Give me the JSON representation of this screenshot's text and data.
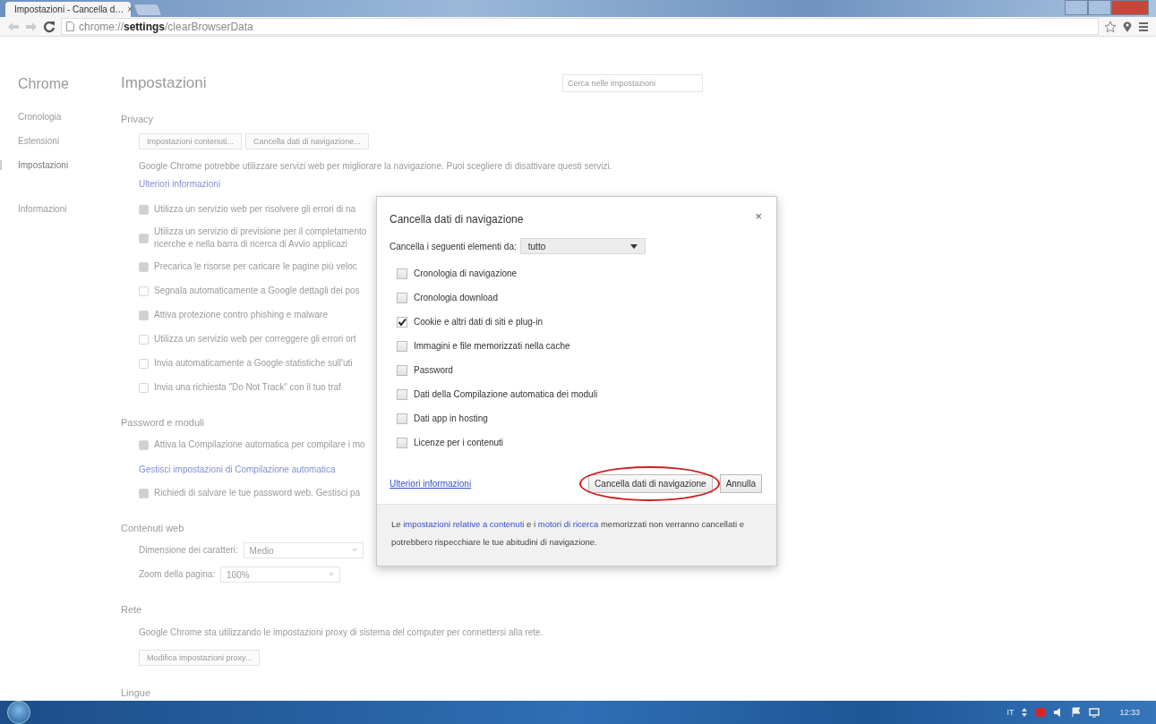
{
  "browser": {
    "tab": {
      "title": "Impostazioni - Cancella d…",
      "close": "×"
    },
    "address": {
      "prefix": "chrome://",
      "bold": "settings",
      "rest": "/clearBrowserData"
    }
  },
  "sidebar": {
    "title": "Chrome",
    "items": [
      {
        "label": "Cronologia",
        "selected": false
      },
      {
        "label": "Estensioni",
        "selected": false
      },
      {
        "label": "Impostazioni",
        "selected": true
      },
      {
        "label": "Informazioni",
        "selected": false
      }
    ]
  },
  "settings": {
    "title": "Impostazioni",
    "search": {
      "placeholder": "Cerca nelle impostazioni"
    },
    "privacy": {
      "heading": "Privacy",
      "buttons": [
        "Impostazioni contenuti...",
        "Cancella dati di navigazione..."
      ],
      "text": "Google Chrome potrebbe utilizzare servizi web per migliorare la navigazione. Puoi scegliere di disattivare questi servizi.",
      "link": "Ulteriori informazioni",
      "options": [
        {
          "label": "Utilizza un servizio web per risolvere gli errori di na",
          "checked": true
        },
        {
          "label": "Utilizza un servizio di previsione per il completamento\nricerche e nella barra di ricerca di Avvio applicazi",
          "checked": true
        },
        {
          "label": "Precarica le risorse per caricare le pagine più veloc",
          "checked": true
        },
        {
          "label": "Segnala automaticamente a Google dettagli dei pos",
          "checked": false
        },
        {
          "label": "Attiva protezione contro phishing e malware",
          "checked": true
        },
        {
          "label": "Utilizza un servizio web per correggere gli errori ort",
          "checked": false
        },
        {
          "label": "Invia automaticamente a Google statistiche sull'uti",
          "checked": false
        },
        {
          "label": "Invia una richiesta \"Do Not Track\" con il tuo traf",
          "checked": false
        }
      ]
    },
    "passwords": {
      "heading": "Password e moduli",
      "items": [
        {
          "kind": "checkbox",
          "label": "Attiva la Compilazione automatica per compilare i mo",
          "checked": true
        },
        {
          "kind": "link",
          "label": "Gestisci impostazioni di Compilazione automatica"
        },
        {
          "kind": "checkbox",
          "label": "Richiedi di salvare le tue password web. Gestisci pa",
          "checked": true
        }
      ]
    },
    "web_content": {
      "heading": "Contenuti web",
      "rows": [
        {
          "label": "Dimensione dei caratteri:",
          "value": "Medio"
        },
        {
          "label": "Zoom della pagina:",
          "value": "100%"
        }
      ]
    },
    "network": {
      "heading": "Rete",
      "text": "Google Chrome sta utilizzando le impostazioni proxy di sistema del computer per connettersi alla rete.",
      "button": "Modifica impostazioni proxy..."
    },
    "languages": {
      "heading": "Lingue"
    }
  },
  "dialog": {
    "title": "Cancella dati di navigazione",
    "close": "×",
    "range_label": "Cancella i seguenti elementi da:",
    "range_value": "tutto",
    "options": [
      {
        "label": "Cronologia di navigazione",
        "checked": false
      },
      {
        "label": "Cronologia download",
        "checked": false
      },
      {
        "label": "Cookie e altri dati di siti e plug-in",
        "checked": true
      },
      {
        "label": "Immagini e file memorizzati nella cache",
        "checked": false
      },
      {
        "label": "Password",
        "checked": false
      },
      {
        "label": "Dati della Compilazione automatica dei moduli",
        "checked": false
      },
      {
        "label": "Dati app in hosting",
        "checked": false
      },
      {
        "label": "Licenze per i contenuti",
        "checked": false
      }
    ],
    "link": "Ulteriori informazioni",
    "buttons": [
      {
        "label": "Cancella dati di navigazione",
        "circled": true
      },
      {
        "label": "Annulla",
        "circled": false
      }
    ],
    "footer": [
      {
        "kind": "text",
        "text": "Le "
      },
      {
        "kind": "link",
        "text": "impostazioni relative a contenuti"
      },
      {
        "kind": "text",
        "text": " e i "
      },
      {
        "kind": "link",
        "text": "motori di ricerca"
      },
      {
        "kind": "text",
        "text": " memorizzati non verranno cancellati e potrebbero rispecchiare le tue abitudini di navigazione."
      }
    ]
  },
  "taskbar": {
    "language": "IT",
    "time": "12:33"
  }
}
